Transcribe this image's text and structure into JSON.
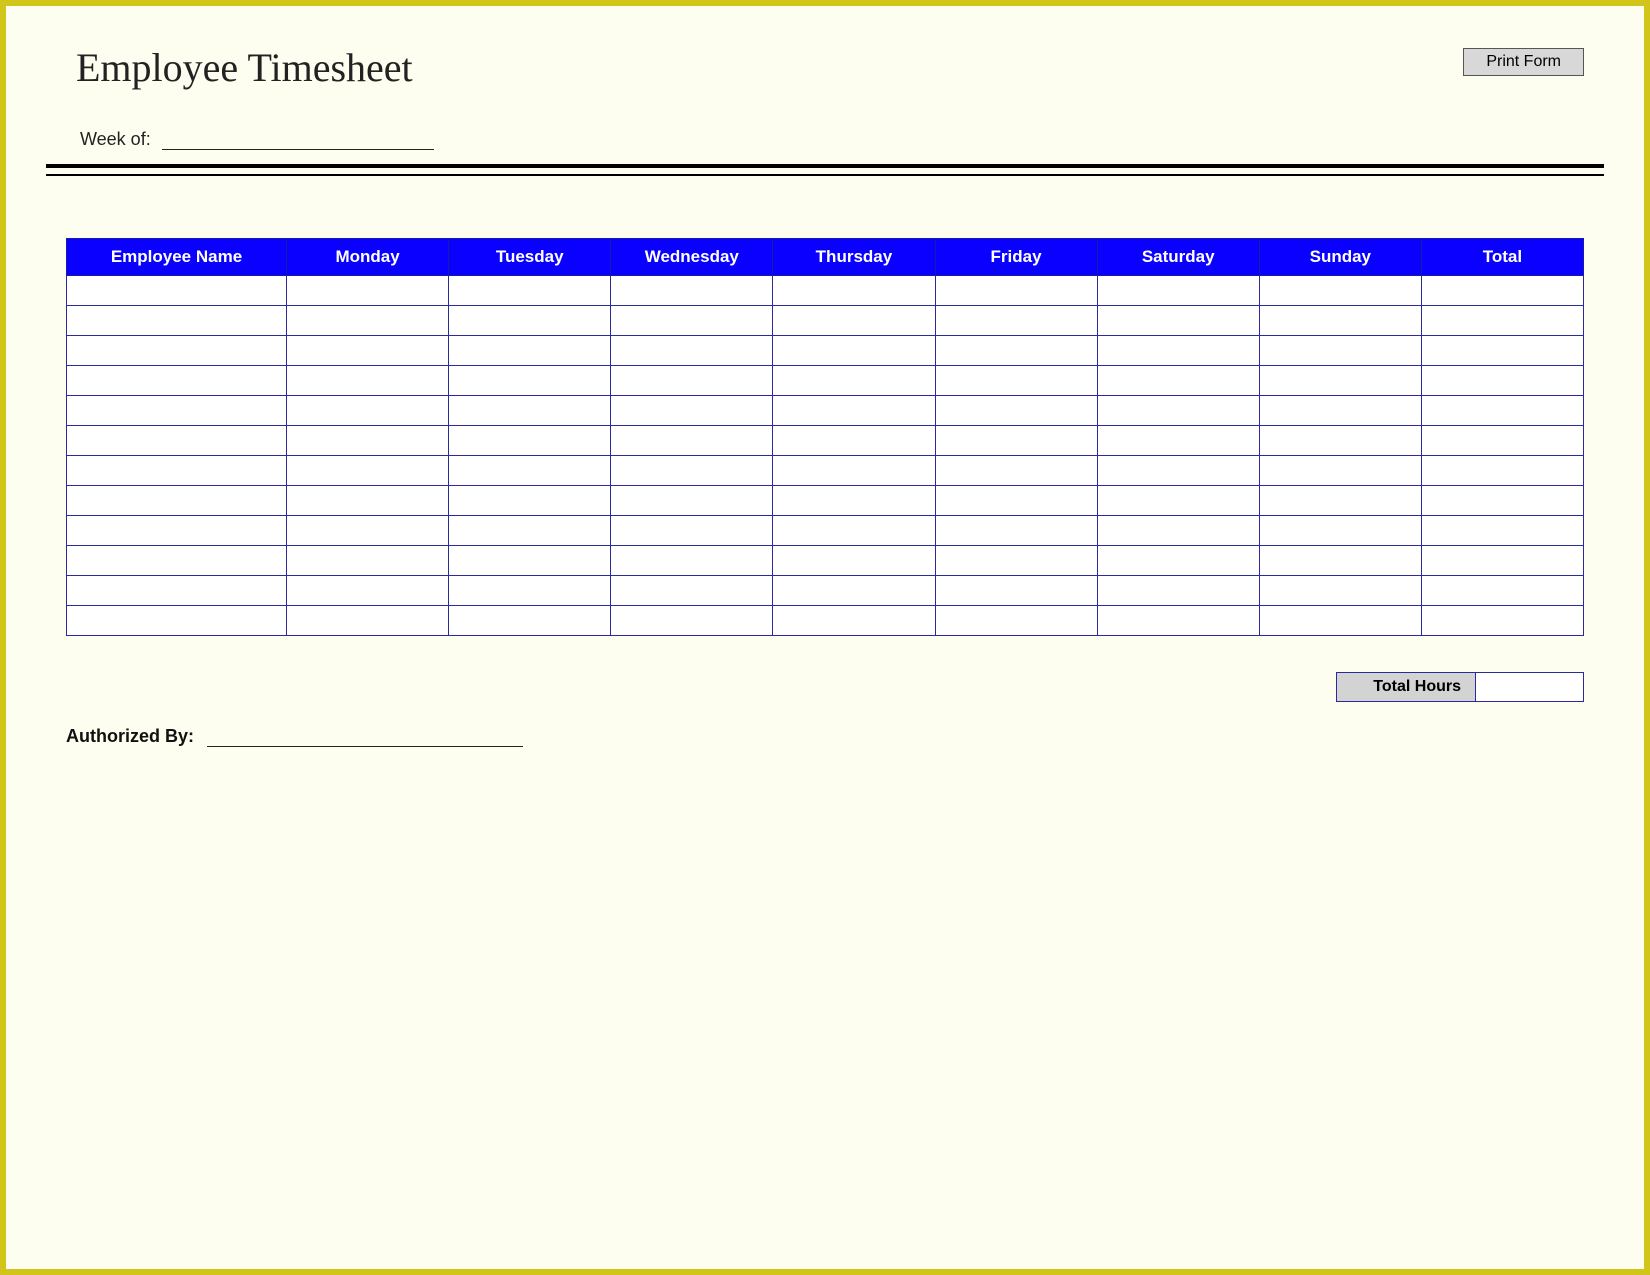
{
  "title": "Employee Timesheet",
  "print_button_label": "Print Form",
  "week_of_label": "Week of:",
  "week_of_value": "",
  "table": {
    "headers": [
      "Employee Name",
      "Monday",
      "Tuesday",
      "Wednesday",
      "Thursday",
      "Friday",
      "Saturday",
      "Sunday",
      "Total"
    ],
    "row_count": 12
  },
  "total_hours_label": "Total Hours",
  "total_hours_value": "",
  "authorized_by_label": "Authorized By:",
  "authorized_by_value": ""
}
